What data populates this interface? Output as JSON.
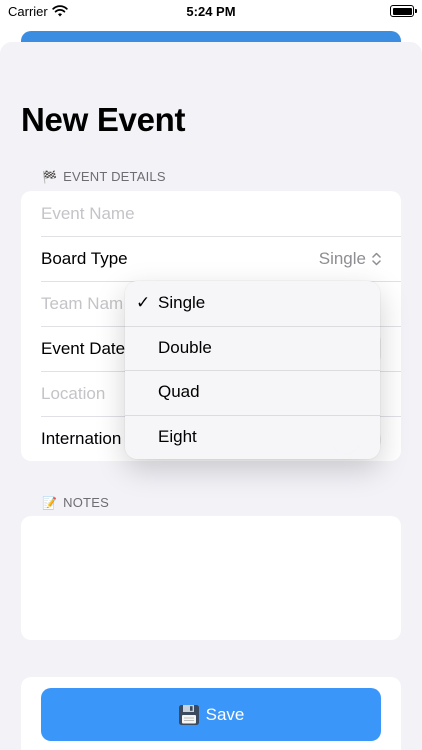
{
  "status_bar": {
    "carrier": "Carrier",
    "time": "5:24 PM"
  },
  "page": {
    "title": "New Event"
  },
  "event_details": {
    "header_emoji": "🏁",
    "header": "EVENT DETAILS",
    "event_name_placeholder": "Event Name",
    "board_type_label": "Board Type",
    "board_type_value": "Single",
    "team_name_placeholder": "Team Nam",
    "event_date_label": "Event Date",
    "location_placeholder": "Location",
    "international_label": "Internation"
  },
  "board_type_menu": {
    "selected": "Single",
    "check_mark": "✓",
    "options": [
      "Single",
      "Double",
      "Quad",
      "Eight"
    ]
  },
  "notes": {
    "header_emoji": "📝",
    "header": "NOTES"
  },
  "save": {
    "label": "Save"
  },
  "colors": {
    "accent": "#3a96f8",
    "background": "#f2f2f7",
    "top_card": "#3a8de0"
  }
}
